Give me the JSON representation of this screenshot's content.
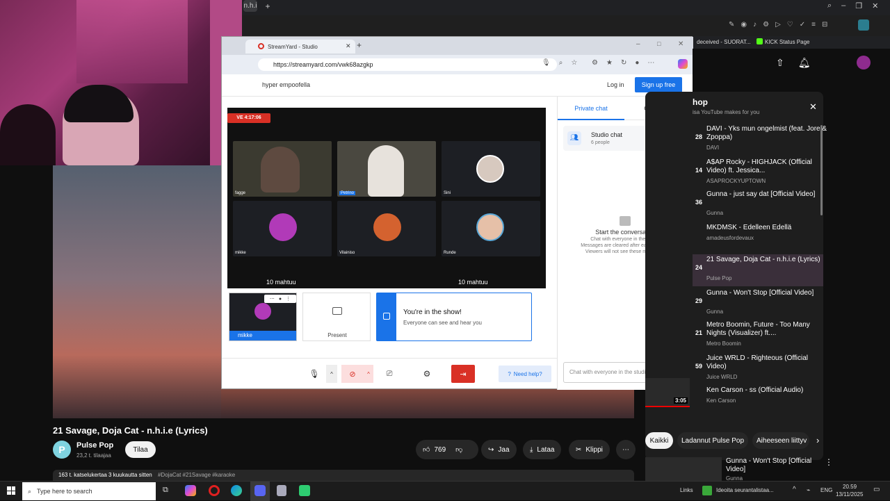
{
  "browser": {
    "tab_nhie": "n.h.i",
    "plus": "+"
  },
  "streamyard": {
    "tab_title": "StreamYard - Studio",
    "url": "https://streamyard.com/vwk68azgkp",
    "studio_name": "hyper empoofella",
    "login": "Log in",
    "signup": "Sign up free",
    "live_badge": "VE 4:17:06",
    "participants": [
      {
        "name": "fagge"
      },
      {
        "name": "Petrino"
      },
      {
        "name": "Sini"
      },
      {
        "name": "mikke"
      },
      {
        "name": "Vilainiso"
      },
      {
        "name": "Runde"
      }
    ],
    "capacity_left": "10 mahtuu",
    "capacity_right": "10 mahtuu",
    "self_name": "mikke",
    "present_label": "Present",
    "show_title": "You're in the show!",
    "show_sub": "Everyone can see and hear you",
    "need_help": "Need help?",
    "tabs": {
      "private": "Private chat",
      "comments": "Comments"
    },
    "studio_chat": {
      "title": "Studio chat",
      "sub": "6 people"
    },
    "empty_title": "Start the conversation",
    "empty_lines": [
      "Chat with everyone in the studio.",
      "Messages are cleared after each session.",
      "Viewers will not see these messages."
    ],
    "chat_placeholder": "Chat with everyone in the studio"
  },
  "ext_tabs": {
    "tab1": "deceived - SUORAT...",
    "tab2": "KICK Status Page"
  },
  "playlist": {
    "title": "hop",
    "subtitle": "isa YouTube makes for you",
    "items": [
      {
        "num": "28",
        "title": "DAVI - Yks mun ongelmist (feat. Jore & Zpoppa)",
        "channel": "DAVI"
      },
      {
        "num": "14",
        "title": "A$AP Rocky - HIGHJACK (Official Video) ft. Jessica...",
        "channel": "ASAPROCKYUPTOWN"
      },
      {
        "num": "36",
        "title": "Gunna - just say dat [Official Video]",
        "channel": "Gunna"
      },
      {
        "num": "",
        "title": "MKDMSK - Edelleen Edellä",
        "channel": "amadeusfordevaux"
      },
      {
        "num": "24",
        "title": "21 Savage, Doja Cat - n.h.i.e (Lyrics)",
        "channel": "Pulse Pop"
      },
      {
        "num": "29",
        "title": "Gunna - Won't Stop [Official Video]",
        "channel": "Gunna"
      },
      {
        "num": "21",
        "title": "Metro Boomin, Future - Too Many Nights (Visualizer) ft....",
        "channel": "Metro Boomin"
      },
      {
        "num": "59",
        "title": "Juice WRLD - Righteous (Official Video)",
        "channel": "Juice WRLD"
      },
      {
        "num": "",
        "title": "Ken Carson - ss (Official Audio)",
        "channel": "Ken Carson"
      }
    ],
    "ken_duration": "3:05"
  },
  "chips": [
    "Kaikki",
    "Ladannut Pulse Pop",
    "Aiheeseen liittyv"
  ],
  "video": {
    "title": "21 Savage, Doja Cat - n.h.i.e (Lyrics)",
    "channel": "Pulse Pop",
    "subs": "23,2 t. tilaajaa",
    "subscribe": "Tilaa",
    "likes": "769",
    "share": "Jaa",
    "download": "Lataa",
    "clip": "Klippi",
    "meta": "163 t. katselukertaa  3 kuukautta sitten",
    "tags": "#DojaCat #21Savage #karaoke"
  },
  "next_video": {
    "title": "Gunna - Won't Stop [Official Video]",
    "channel": "Gunna"
  },
  "taskbar": {
    "search": "Type here to search",
    "links": "Links",
    "news": "Ideoita seurantalistaa...",
    "lang": "ENG",
    "time": "20.59",
    "date": "13/11/2025"
  },
  "colors": {
    "accent": "#1a73e8",
    "live": "#d93025",
    "yt_bg": "#0f0f0f"
  }
}
